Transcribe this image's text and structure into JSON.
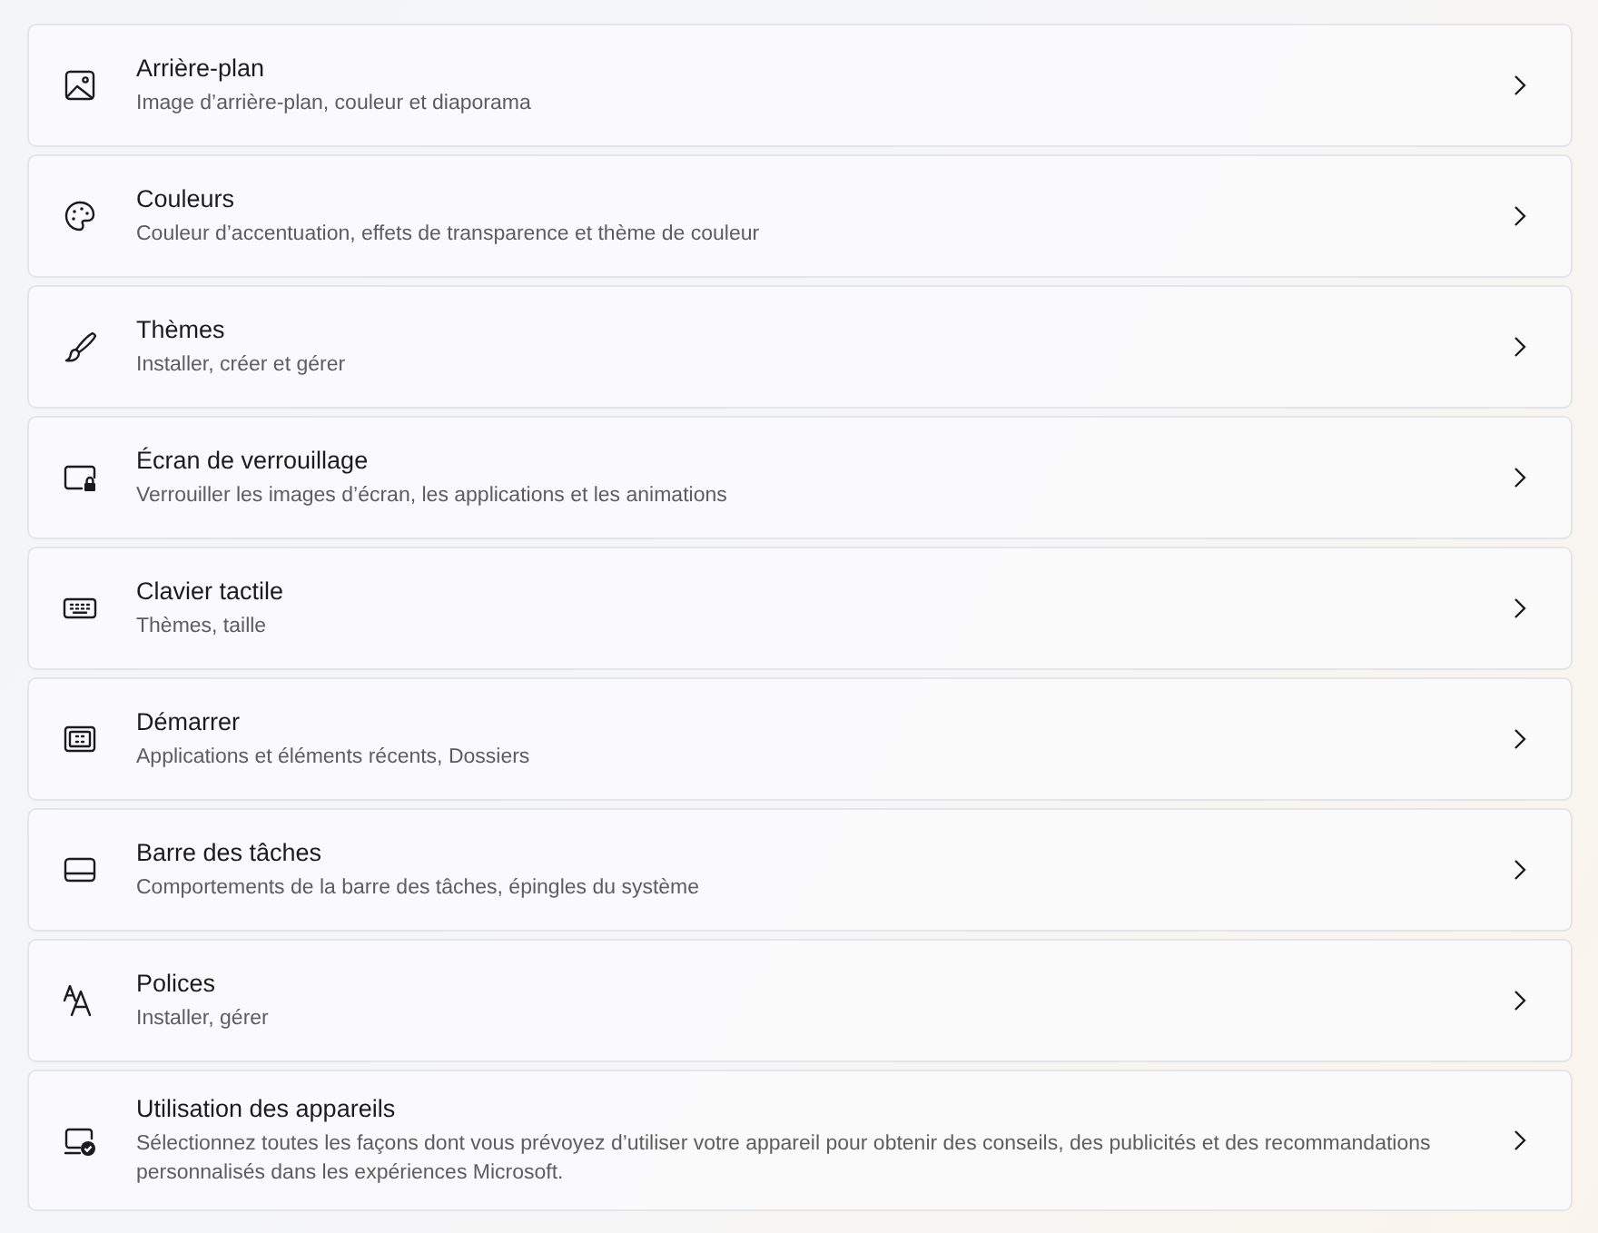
{
  "items": [
    {
      "kind": "picture",
      "title": "Arrière-plan",
      "description": "Image d’arrière-plan, couleur et diaporama"
    },
    {
      "kind": "palette",
      "title": "Couleurs",
      "description": "Couleur d’accentuation, effets de transparence et thème de couleur"
    },
    {
      "kind": "brush",
      "title": "Thèmes",
      "description": "Installer, créer et gérer"
    },
    {
      "kind": "lock",
      "title": "Écran de verrouillage",
      "description": "Verrouiller les images d’écran, les applications et les animations"
    },
    {
      "kind": "keyboard",
      "title": "Clavier tactile",
      "description": "Thèmes, taille"
    },
    {
      "kind": "start",
      "title": "Démarrer",
      "description": "Applications et éléments récents, Dossiers"
    },
    {
      "kind": "taskbar",
      "title": "Barre des tâches",
      "description": "Comportements de la barre des tâches, épingles du système"
    },
    {
      "kind": "fonts",
      "title": "Polices",
      "description": "Installer, gérer"
    },
    {
      "kind": "device",
      "title": "Utilisation des appareils",
      "description": "Sélectionnez toutes les façons dont vous prévoyez d’utiliser votre appareil pour obtenir des conseils, des publicités et des recommandations personnalisés dans les expériences Microsoft."
    }
  ]
}
